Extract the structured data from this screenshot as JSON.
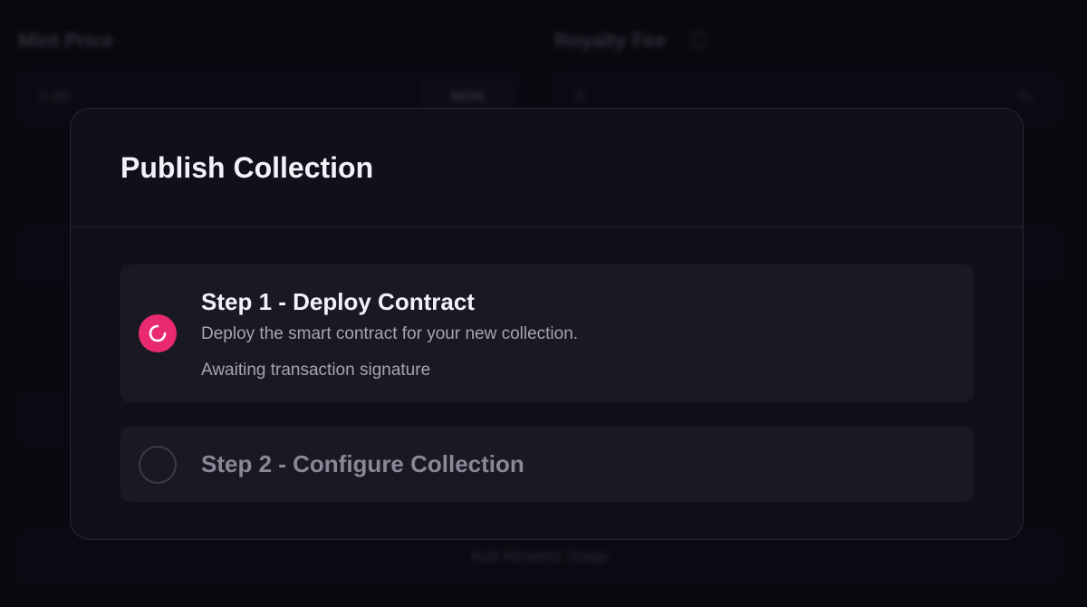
{
  "background": {
    "mint_price_label": "Mint Price",
    "mint_price_placeholder": "0.00",
    "mint_price_unit": "MON",
    "royalty_fee_label": "Royalty Fee",
    "royalty_fee_placeholder": "0",
    "royalty_fee_unit": "%",
    "add_stage_label": "Add Allowlist Stage"
  },
  "modal": {
    "title": "Publish Collection",
    "steps": [
      {
        "title": "Step 1 - Deploy Contract",
        "description": "Deploy the smart contract for your new collection.",
        "status": "Awaiting transaction signature",
        "state": "in-progress"
      },
      {
        "title": "Step 2 - Configure Collection",
        "state": "pending"
      }
    ]
  },
  "colors": {
    "accent": "#ea2a6f",
    "modal_bg": "#110f19",
    "step_bg": "#1a1823"
  }
}
